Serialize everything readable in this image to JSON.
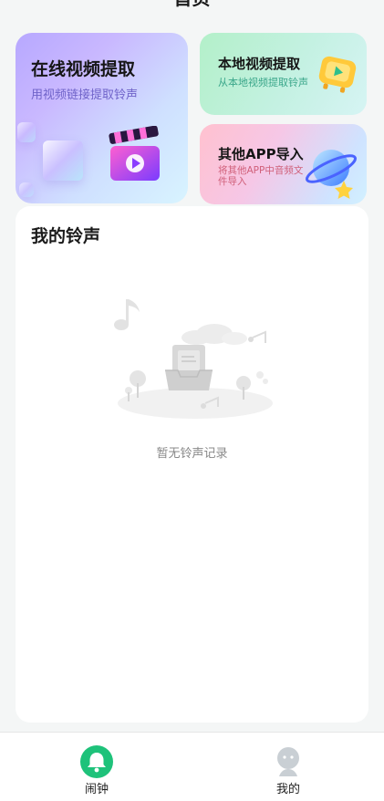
{
  "header": {
    "title": "首页"
  },
  "cards": {
    "online": {
      "title": "在线视频提取",
      "subtitle": "用视频链接提取铃声"
    },
    "local": {
      "title": "本地视频提取",
      "subtitle": "从本地视频提取铃声"
    },
    "other": {
      "title": "其他APP导入",
      "subtitle": "将其他APP中音频文件导入"
    }
  },
  "ringtones": {
    "heading": "我的铃声",
    "empty_text": "暂无铃声记录"
  },
  "bottom_nav": {
    "items": [
      {
        "label": "闹钟",
        "icon": "alarm-bell-icon",
        "active": true
      },
      {
        "label": "我的",
        "icon": "profile-icon",
        "active": false
      }
    ]
  },
  "colors": {
    "accent": "#1ec27a",
    "inactive_icon": "#c9cfd4",
    "background": "#f4f6f6"
  }
}
